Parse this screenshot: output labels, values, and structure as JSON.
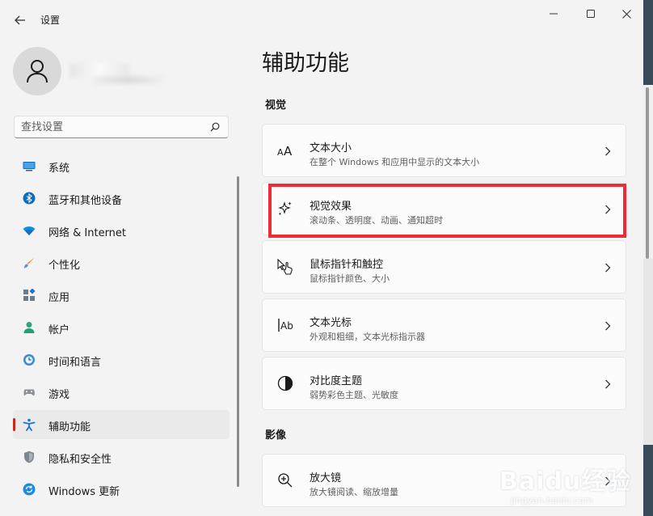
{
  "window": {
    "title": "设置"
  },
  "user": {
    "name": ""
  },
  "search": {
    "placeholder": "查找设置",
    "value": ""
  },
  "nav": {
    "items": [
      {
        "label": "系统",
        "icon": "system-icon",
        "active": false
      },
      {
        "label": "蓝牙和其他设备",
        "icon": "bluetooth-icon",
        "active": false
      },
      {
        "label": "网络 & Internet",
        "icon": "wifi-icon",
        "active": false
      },
      {
        "label": "个性化",
        "icon": "brush-icon",
        "active": false
      },
      {
        "label": "应用",
        "icon": "apps-icon",
        "active": false
      },
      {
        "label": "帐户",
        "icon": "account-icon",
        "active": false
      },
      {
        "label": "时间和语言",
        "icon": "clock-globe-icon",
        "active": false
      },
      {
        "label": "游戏",
        "icon": "gamepad-icon",
        "active": false
      },
      {
        "label": "辅助功能",
        "icon": "accessibility-icon",
        "active": true
      },
      {
        "label": "隐私和安全性",
        "icon": "shield-icon",
        "active": false
      },
      {
        "label": "Windows 更新",
        "icon": "update-icon",
        "active": false
      }
    ]
  },
  "main": {
    "title": "辅助功能",
    "sections": [
      {
        "label": "视觉",
        "cards": [
          {
            "title": "文本大小",
            "desc": "在整个 Windows 和应用中显示的文本大小",
            "icon": "text-size-icon"
          },
          {
            "title": "视觉效果",
            "desc": "滚动条、透明度、动画、通知超时",
            "icon": "sparkle-icon"
          },
          {
            "title": "鼠标指针和触控",
            "desc": "鼠标指针颜色、大小",
            "icon": "pointer-touch-icon"
          },
          {
            "title": "文本光标",
            "desc": "外观和粗细，文本光标指示器",
            "icon": "text-cursor-icon"
          },
          {
            "title": "对比度主题",
            "desc": "弱势彩色主题、光敏度",
            "icon": "contrast-icon"
          }
        ]
      },
      {
        "label": "影像",
        "cards": [
          {
            "title": "放大镜",
            "desc": "放大镜阅读、缩放增量",
            "icon": "magnifier-icon"
          }
        ]
      }
    ]
  },
  "watermark": {
    "brand": "Baidu经验",
    "url": "jingyan.baidu.com"
  },
  "colors": {
    "accent": "#c42b1c",
    "highlight": "#ee2c37",
    "background": "#f3f3f3",
    "card": "#fbfbfb"
  }
}
